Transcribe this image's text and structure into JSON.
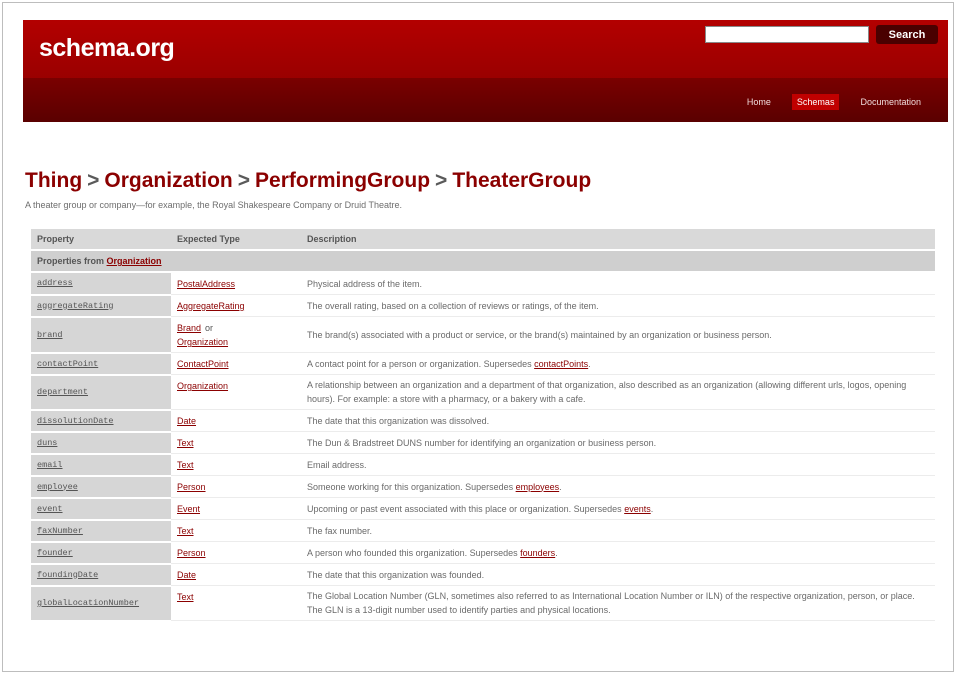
{
  "header": {
    "logo": "schema.org",
    "search_placeholder": "",
    "search_button": "Search",
    "nav": [
      {
        "label": "Home",
        "active": false
      },
      {
        "label": "Schemas",
        "active": true
      },
      {
        "label": "Documentation",
        "active": false
      }
    ]
  },
  "breadcrumb": {
    "items": [
      "Thing",
      "Organization",
      "PerformingGroup",
      "TheaterGroup"
    ],
    "separator": ">"
  },
  "intro": "A theater group or company—for example, the Royal Shakespeare Company or Druid Theatre.",
  "table": {
    "headers": [
      "Property",
      "Expected Type",
      "Description"
    ],
    "group_label": "Properties from ",
    "group_link": "Organization",
    "rows": [
      {
        "property": "address",
        "types": [
          "PostalAddress"
        ],
        "description": "Physical address of the item."
      },
      {
        "property": "aggregateRating",
        "types": [
          "AggregateRating"
        ],
        "description": "The overall rating, based on a collection of reviews or ratings, of the item."
      },
      {
        "property": "brand",
        "types": [
          "Brand",
          "or",
          "Organization"
        ],
        "description": "The brand(s) associated with a product or service, or the brand(s) maintained by an organization or business person."
      },
      {
        "property": "contactPoint",
        "types": [
          "ContactPoint"
        ],
        "description": "A contact point for a person or organization. Supersedes ",
        "link": "contactPoints",
        "after": "."
      },
      {
        "property": "department",
        "types": [
          "Organization"
        ],
        "description": "A relationship between an organization and a department of that organization, also described as an organization (allowing different urls, logos, opening hours). For example: a store with a pharmacy, or a bakery with a cafe."
      },
      {
        "property": "dissolutionDate",
        "types": [
          "Date"
        ],
        "description": "The date that this organization was dissolved."
      },
      {
        "property": "duns",
        "types": [
          "Text"
        ],
        "description": "The Dun & Bradstreet DUNS number for identifying an organization or business person."
      },
      {
        "property": "email",
        "types": [
          "Text"
        ],
        "description": "Email address."
      },
      {
        "property": "employee",
        "types": [
          "Person"
        ],
        "description": "Someone working for this organization. Supersedes ",
        "link": "employees",
        "after": "."
      },
      {
        "property": "event",
        "types": [
          "Event"
        ],
        "description": "Upcoming or past event associated with this place or organization. Supersedes ",
        "link": "events",
        "after": "."
      },
      {
        "property": "faxNumber",
        "types": [
          "Text"
        ],
        "description": "The fax number."
      },
      {
        "property": "founder",
        "types": [
          "Person"
        ],
        "description": "A person who founded this organization. Supersedes ",
        "link": "founders",
        "after": "."
      },
      {
        "property": "foundingDate",
        "types": [
          "Date"
        ],
        "description": "The date that this organization was founded."
      },
      {
        "property": "globalLocationNumber",
        "types": [
          "Text"
        ],
        "description": "The Global Location Number (GLN, sometimes also referred to as International Location Number or ILN) of the respective organization, person, or place. The GLN is a 13-digit number used to identify parties and physical locations."
      }
    ]
  }
}
